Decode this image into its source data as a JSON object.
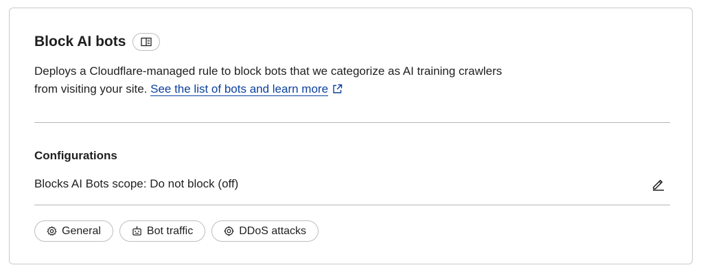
{
  "card": {
    "title": "Block AI bots",
    "doc_icon": "book-open-icon",
    "description_text": "Deploys a Cloudflare-managed rule to block bots that we categorize as AI training crawlers from visiting your site.",
    "learn_more_link": "See the list of bots and learn more",
    "external_icon": "external-link-icon"
  },
  "configurations": {
    "title": "Configurations",
    "scope_text": "Blocks AI Bots scope: Do not block (off)",
    "edit_icon": "pencil-icon"
  },
  "tags": [
    {
      "label": "General",
      "icon": "gear-icon"
    },
    {
      "label": "Bot traffic",
      "icon": "robot-icon"
    },
    {
      "label": "DDoS attacks",
      "icon": "target-icon"
    }
  ],
  "colors": {
    "link": "#0a3f9e",
    "border": "#c9c9c9",
    "text": "#1f1f1f"
  }
}
